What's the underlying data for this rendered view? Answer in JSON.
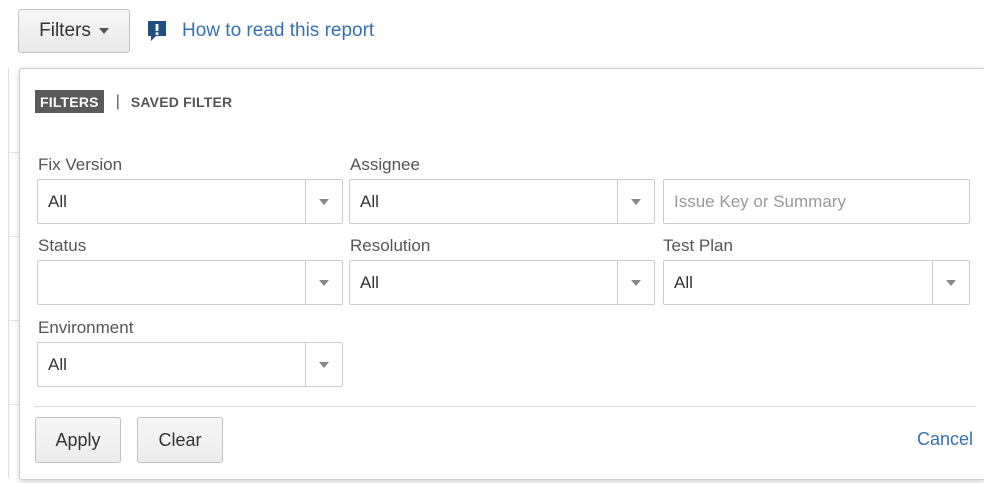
{
  "toolbar": {
    "filters_label": "Filters",
    "help_link": "How to read this report"
  },
  "panel": {
    "tabs": {
      "active": "FILTERS",
      "separator": "|",
      "inactive": "SAVED FILTER"
    },
    "fields": {
      "fix_version": {
        "label": "Fix Version",
        "value": "All"
      },
      "assignee": {
        "label": "Assignee",
        "value": "All"
      },
      "search": {
        "placeholder": "Issue Key or Summary",
        "value": ""
      },
      "status": {
        "label": "Status",
        "value": ""
      },
      "resolution": {
        "label": "Resolution",
        "value": "All"
      },
      "test_plan": {
        "label": "Test Plan",
        "value": "All"
      },
      "environment": {
        "label": "Environment",
        "value": "All"
      }
    },
    "actions": {
      "apply": "Apply",
      "clear": "Clear",
      "cancel": "Cancel"
    }
  },
  "colors": {
    "link": "#3572b0",
    "active_tab_bg": "#5a5a5a",
    "help_icon": "#205081"
  },
  "icons": {
    "filters_caret": "caret-down-icon",
    "help": "feedback-icon",
    "select_arrow": "triangle-down-icon"
  }
}
